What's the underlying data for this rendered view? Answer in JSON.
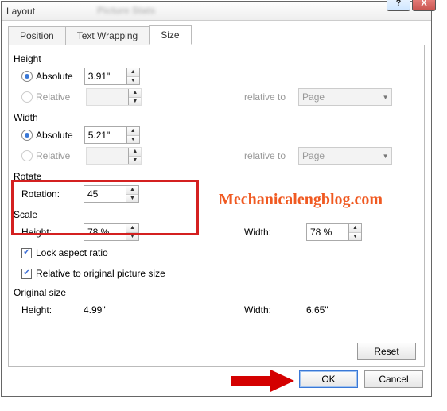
{
  "window": {
    "title": "Layout",
    "blur_caption": "Picture Stats"
  },
  "tabs": {
    "position": "Position",
    "text_wrapping": "Text Wrapping",
    "size": "Size"
  },
  "height": {
    "title": "Height",
    "absolute": "Absolute",
    "absolute_value": "3.91\"",
    "relative": "Relative",
    "relative_value": "",
    "relative_to": "relative to",
    "relative_to_value": "Page"
  },
  "width": {
    "title": "Width",
    "absolute": "Absolute",
    "absolute_value": "5.21\"",
    "relative": "Relative",
    "relative_value": "",
    "relative_to": "relative to",
    "relative_to_value": "Page"
  },
  "rotate": {
    "title": "Rotate",
    "rotation": "Rotation:",
    "rotation_value": "45"
  },
  "scale": {
    "title": "Scale",
    "height": "Height:",
    "height_value": "78 %",
    "width": "Width:",
    "width_value": "78 %",
    "lock": "Lock aspect ratio",
    "relative_original": "Relative to original picture size"
  },
  "original": {
    "title": "Original size",
    "height": "Height:",
    "height_value": "4.99\"",
    "width": "Width:",
    "width_value": "6.65\""
  },
  "buttons": {
    "reset": "Reset",
    "ok": "OK",
    "cancel": "Cancel",
    "help": "?",
    "close": "X"
  },
  "watermark": "Mechanicalengblog.com"
}
